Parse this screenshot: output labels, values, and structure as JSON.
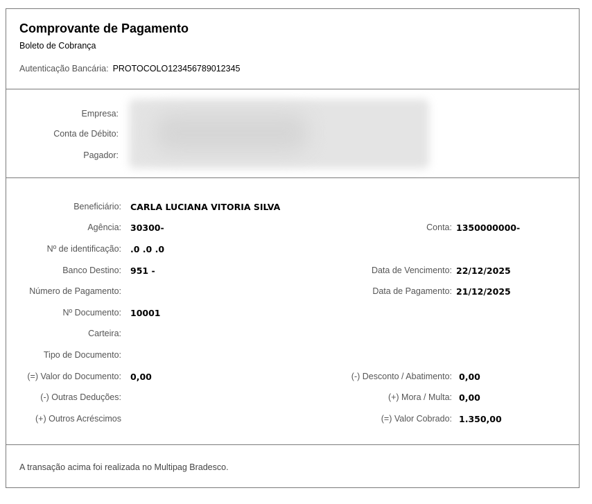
{
  "header": {
    "title": "Comprovante de Pagamento",
    "subtitle": "Boleto de Cobrança",
    "auth_label": "Autenticação Bancária:",
    "auth_value": "PROTOCOLO123456789012345"
  },
  "parties": {
    "empresa_label": "Empresa:",
    "conta_debito_label": "Conta de Débito:",
    "pagador_label": "Pagador:"
  },
  "details": {
    "beneficiario_label": "Beneficiário:",
    "beneficiario_value": "CARLA LUCIANA VITORIA SILVA",
    "agencia_label": "Agência:",
    "agencia_value": "30300-",
    "conta_label": "Conta:",
    "conta_value": "1350000000-",
    "identificacao_label": "Nº de identificação:",
    "identificacao_value": ".0 .0 .0",
    "banco_label": "Banco Destino:",
    "banco_value": "951 -",
    "vencimento_label": "Data de Vencimento:",
    "vencimento_value": "22/12/2025",
    "numero_pagamento_label": "Número de Pagamento:",
    "data_pagamento_label": "Data de Pagamento:",
    "data_pagamento_value": "21/12/2025",
    "documento_label": "Nº Documento:",
    "documento_value": "10001",
    "carteira_label": "Carteira:",
    "tipo_documento_label": "Tipo de Documento:",
    "valor_documento_label": "(=) Valor do Documento:",
    "valor_documento_value": "0,00",
    "desconto_label": "(-) Desconto / Abatimento:",
    "desconto_value": "0,00",
    "outras_deducoes_label": "(-) Outras Deduções:",
    "mora_label": "(+) Mora / Multa:",
    "mora_value": "0,00",
    "outros_acrescimos_label": "(+) Outros Acréscimos",
    "valor_cobrado_label": "(=) Valor Cobrado:",
    "valor_cobrado_value": "1.350,00"
  },
  "footer": {
    "text": "A transação acima foi realizada no Multipag Bradesco."
  }
}
